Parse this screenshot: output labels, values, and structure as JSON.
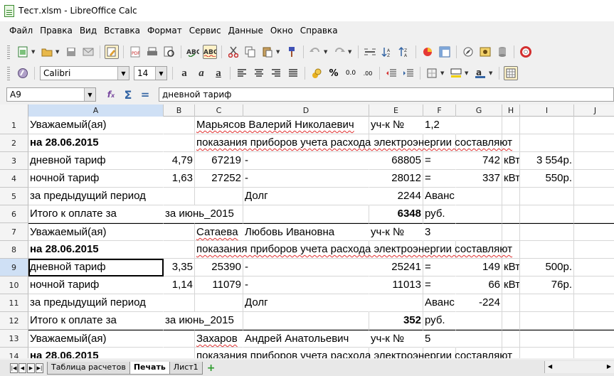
{
  "window": {
    "title": "Тест.xlsm - LibreOffice Calc"
  },
  "menu": [
    "Файл",
    "Правка",
    "Вид",
    "Вставка",
    "Формат",
    "Сервис",
    "Данные",
    "Окно",
    "Справка"
  ],
  "toolbar2": {
    "font_name": "Calibri",
    "font_size": "14"
  },
  "formula_bar": {
    "cell_ref": "A9",
    "content": "дневной тариф"
  },
  "columns": [
    "A",
    "B",
    "C",
    "D",
    "E",
    "F",
    "G",
    "H",
    "I",
    "J"
  ],
  "rows": [
    {
      "n": "1",
      "A": "Уважаемый(ая)",
      "C": "Марьясов Валерий Николаевич",
      "E": "уч-к №",
      "F": "1,2"
    },
    {
      "n": "2",
      "A": "на 28.06.2015",
      "C": "показания приборов учета расхода электроэнергии составляют"
    },
    {
      "n": "3",
      "A": "дневной тариф",
      "B": "4,79",
      "C": "67219",
      "D": "-",
      "E": "68805",
      "F": "=",
      "G": "742",
      "H": "кВт",
      "I": "3 554р."
    },
    {
      "n": "4",
      "A": "ночной тариф",
      "B": "1,63",
      "C": "27252",
      "D": "-",
      "E": "28012",
      "F": "=",
      "G": "337",
      "H": "кВт",
      "I": "550р."
    },
    {
      "n": "5",
      "A": "за предыдущий период",
      "D": "Долг",
      "E": "2244",
      "F": "Аванс"
    },
    {
      "n": "6",
      "A": "Итого к оплате за",
      "B": "за июнь_2015",
      "E": "6348",
      "F": "руб."
    },
    {
      "n": "7",
      "A": "Уважаемый(ая)",
      "C": "Сатаева",
      "D": "Любовь Ивановна",
      "E": "уч-к №",
      "F": "3"
    },
    {
      "n": "8",
      "A": "на 28.06.2015",
      "C": "показания приборов учета расхода электроэнергии составляют"
    },
    {
      "n": "9",
      "A": "дневной тариф",
      "B": "3,35",
      "C": "25390",
      "D": "-",
      "E": "25241",
      "F": "=",
      "G": "149",
      "H": "кВт",
      "I": "500р."
    },
    {
      "n": "10",
      "A": "ночной тариф",
      "B": "1,14",
      "C": "11079",
      "D": "-",
      "E": "11013",
      "F": "=",
      "G": "66",
      "H": "кВт",
      "I": "76р."
    },
    {
      "n": "11",
      "A": "за предыдущий период",
      "D": "Долг",
      "F": "Аванс",
      "G": "-224"
    },
    {
      "n": "12",
      "A": "Итого к оплате за",
      "B": "за июнь_2015",
      "E": "352",
      "F": "руб."
    },
    {
      "n": "13",
      "A": "Уважаемый(ая)",
      "C": "Захаров",
      "D": "Андрей Анатольевич",
      "E": "уч-к №",
      "F": "5"
    },
    {
      "n": "14",
      "A": "на 28.06.2015",
      "C": "показания приборов учета расхода электроэнергии составляют"
    }
  ],
  "sheet_tabs": [
    "Таблица расчетов",
    "Печать",
    "Лист1"
  ],
  "active_sheet": "Печать"
}
